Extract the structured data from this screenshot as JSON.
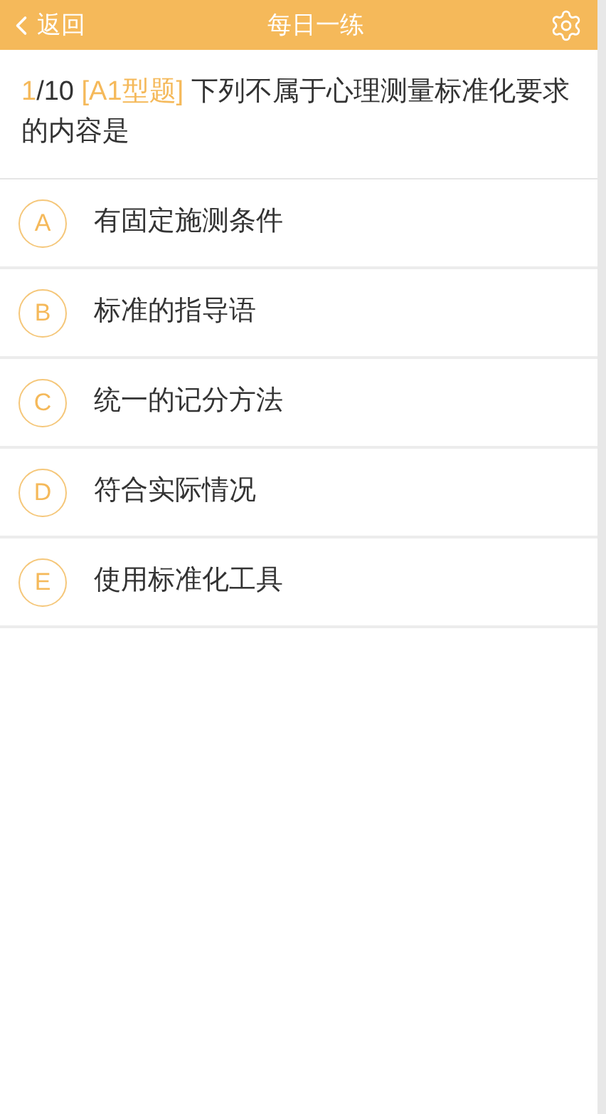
{
  "header": {
    "back": "返回",
    "title": "每日一练"
  },
  "question": {
    "index": "1",
    "total": "/10",
    "type": "[A1型题]",
    "text": "下列不属于心理测量标准化要求的内容是"
  },
  "options": [
    {
      "letter": "A",
      "text": "有固定施测条件"
    },
    {
      "letter": "B",
      "text": "标准的指导语"
    },
    {
      "letter": "C",
      "text": "统一的记分方法"
    },
    {
      "letter": "D",
      "text": "符合实际情况"
    },
    {
      "letter": "E",
      "text": "使用标准化工具"
    }
  ]
}
